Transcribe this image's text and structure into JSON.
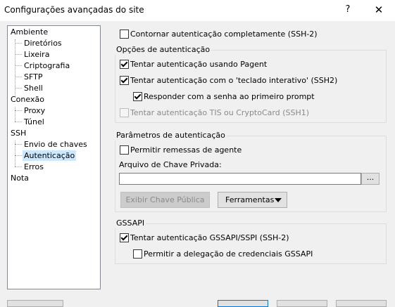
{
  "window": {
    "title": "Configurações avançadas do site",
    "help_label": "?",
    "close_label": "✕"
  },
  "tree": {
    "items": [
      {
        "label": "Ambiente",
        "level": 0
      },
      {
        "label": "Diretórios",
        "level": 1
      },
      {
        "label": "Lixeira",
        "level": 1
      },
      {
        "label": "Criptografia",
        "level": 1
      },
      {
        "label": "SFTP",
        "level": 1
      },
      {
        "label": "Shell",
        "level": 1
      },
      {
        "label": "Conexão",
        "level": 0
      },
      {
        "label": "Proxy",
        "level": 1
      },
      {
        "label": "Túnel",
        "level": 1
      },
      {
        "label": "SSH",
        "level": 0
      },
      {
        "label": "Envio de chaves",
        "level": 1
      },
      {
        "label": "Autenticação",
        "level": 1,
        "selected": true
      },
      {
        "label": "Erros",
        "level": 1
      },
      {
        "label": "Nota",
        "level": 0
      }
    ]
  },
  "bypass": {
    "label": "Contornar autenticação completamente (SSH-2)",
    "checked": false
  },
  "auth_options": {
    "title": "Opções de autenticação",
    "pageant": {
      "label": "Tentar autenticação usando Pagent",
      "checked": true
    },
    "keyboard": {
      "label": "Tentar autenticação com o 'teclado interativo' (SSH2)",
      "checked": true
    },
    "respond_password": {
      "label": "Responder com a senha ao primeiro prompt",
      "checked": true
    },
    "tis": {
      "label": "Tentar autenticação TIS ou CryptoCard (SSH1)",
      "checked": false,
      "disabled": true
    }
  },
  "auth_params": {
    "title": "Parâmetros de autenticação",
    "agent_forwarding": {
      "label": "Permitir remessas de agente",
      "checked": false
    },
    "private_key_label": "Arquivo de Chave Privada:",
    "private_key_value": "",
    "browse_label": "...",
    "show_public_key_label": "Exibir Chave Pública",
    "tools_label": "Ferramentas"
  },
  "gssapi": {
    "title": "GSSAPI",
    "try_gssapi": {
      "label": "Tentar autenticação GSSAPI/SSPI (SSH-2)",
      "checked": true
    },
    "delegation": {
      "label": "Permitir a delegação de credenciais GSSAPI",
      "checked": false
    }
  }
}
